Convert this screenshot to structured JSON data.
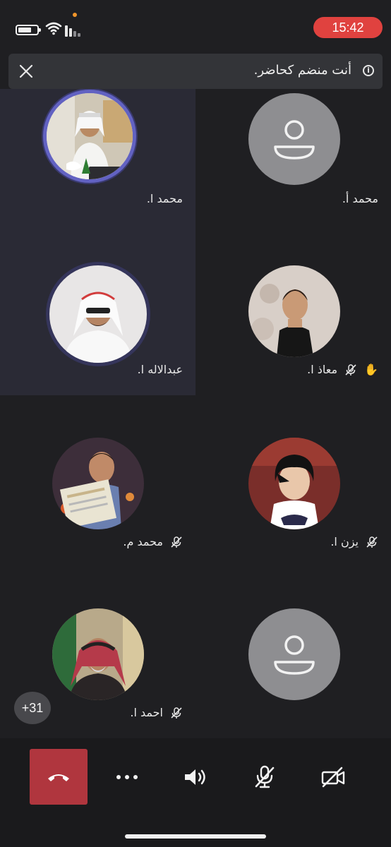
{
  "status_bar": {
    "time": "15:42"
  },
  "banner": {
    "text": "أنت منضم كحاضر.",
    "info_icon": "i"
  },
  "participants": [
    {
      "id": "p1",
      "name": "محمد ا.",
      "speaking": true,
      "muted": false,
      "hand_raised": false
    },
    {
      "id": "p2",
      "name": "محمد أ.",
      "speaking": false,
      "muted": false,
      "hand_raised": false
    },
    {
      "id": "p3",
      "name": "عبدالاله ا.",
      "speaking": true,
      "muted": false,
      "hand_raised": false
    },
    {
      "id": "p4",
      "name": "معاذ ا.",
      "speaking": false,
      "muted": true,
      "hand_raised": true
    },
    {
      "id": "p5",
      "name": "محمد م.",
      "speaking": false,
      "muted": true,
      "hand_raised": false
    },
    {
      "id": "p6",
      "name": "يزن ا.",
      "speaking": false,
      "muted": true,
      "hand_raised": false
    },
    {
      "id": "p7",
      "name": "احمد ا.",
      "speaking": false,
      "muted": true,
      "hand_raised": false
    },
    {
      "id": "p8",
      "name": "",
      "speaking": false,
      "muted": false,
      "hand_raised": false
    }
  ],
  "overflow_count": "+31",
  "controls": {
    "hangup": "hangup-icon",
    "more": "more-icon",
    "speaker": "speaker-icon",
    "mic": "mic-off-icon",
    "camera": "camera-off-icon"
  },
  "colors": {
    "background": "#1f1f22",
    "time_pill": "#e0423f",
    "hangup": "#b0363e",
    "speaking_ring": "#6262c2",
    "hand": "#f0b429"
  }
}
